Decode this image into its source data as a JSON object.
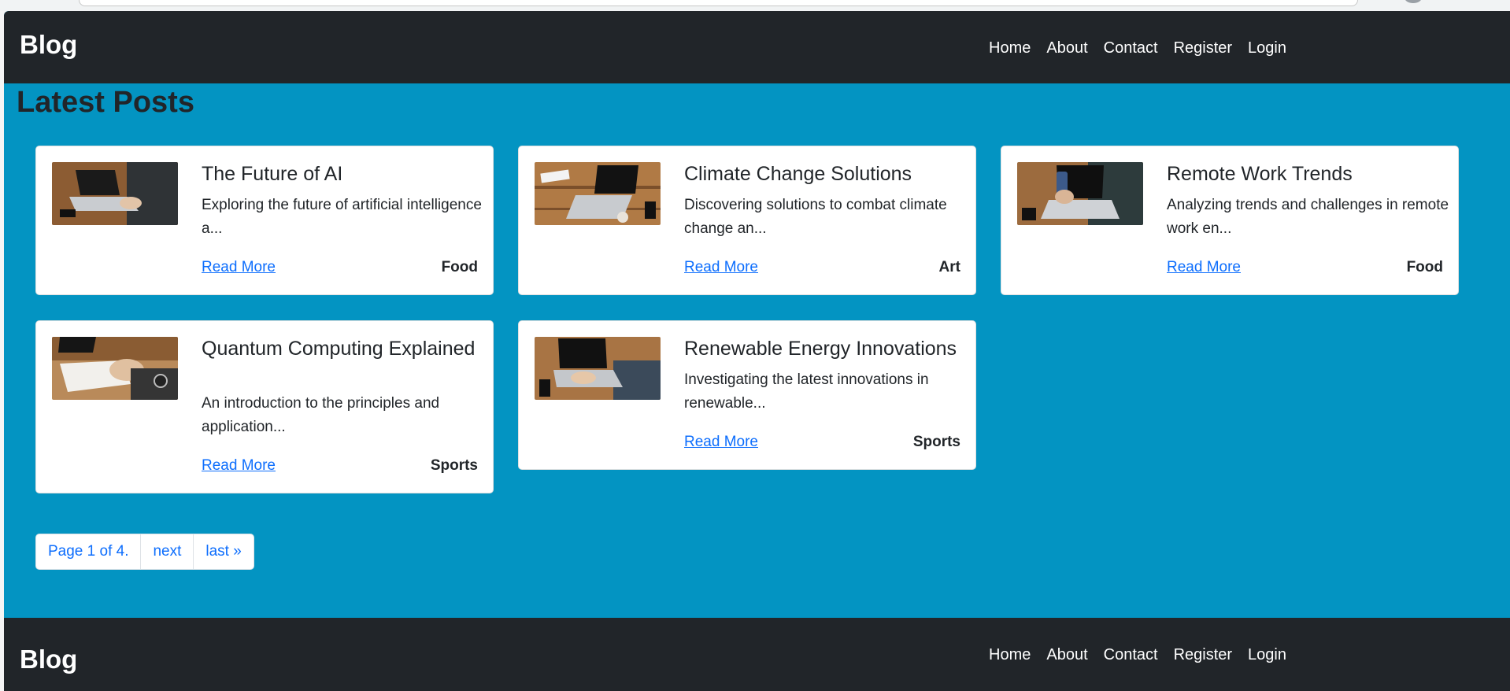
{
  "header": {
    "brand": "Blog",
    "nav": [
      "Home",
      "About",
      "Contact",
      "Register",
      "Login"
    ]
  },
  "main": {
    "title": "Latest Posts",
    "posts": [
      {
        "title": "The Future of AI",
        "excerpt": "Exploring the future of artificial intelligence a...",
        "read_more": "Read More",
        "category": "Food"
      },
      {
        "title": "Climate Change Solutions",
        "excerpt": "Discovering solutions to combat climate change an...",
        "read_more": "Read More",
        "category": "Art"
      },
      {
        "title": "Remote Work Trends",
        "excerpt": "Analyzing trends and challenges in remote work en...",
        "read_more": "Read More",
        "category": "Food"
      },
      {
        "title": "Quantum Computing Explained",
        "excerpt": "An introduction to the principles and application...",
        "read_more": "Read More",
        "category": "Sports"
      },
      {
        "title": "Renewable Energy Innovations",
        "excerpt": "Investigating the latest innovations in renewable...",
        "read_more": "Read More",
        "category": "Sports"
      }
    ],
    "pagination": {
      "status": "Page 1 of 4.",
      "next": "next",
      "last": "last »"
    }
  },
  "footer": {
    "brand": "Blog",
    "nav": [
      "Home",
      "About",
      "Contact",
      "Register",
      "Login"
    ]
  },
  "colors": {
    "page_background": "#0394c2",
    "navbar": "#212529",
    "link": "#0d6efd"
  },
  "icons": {
    "post_thumbnail": "laptop-photo-icon"
  }
}
